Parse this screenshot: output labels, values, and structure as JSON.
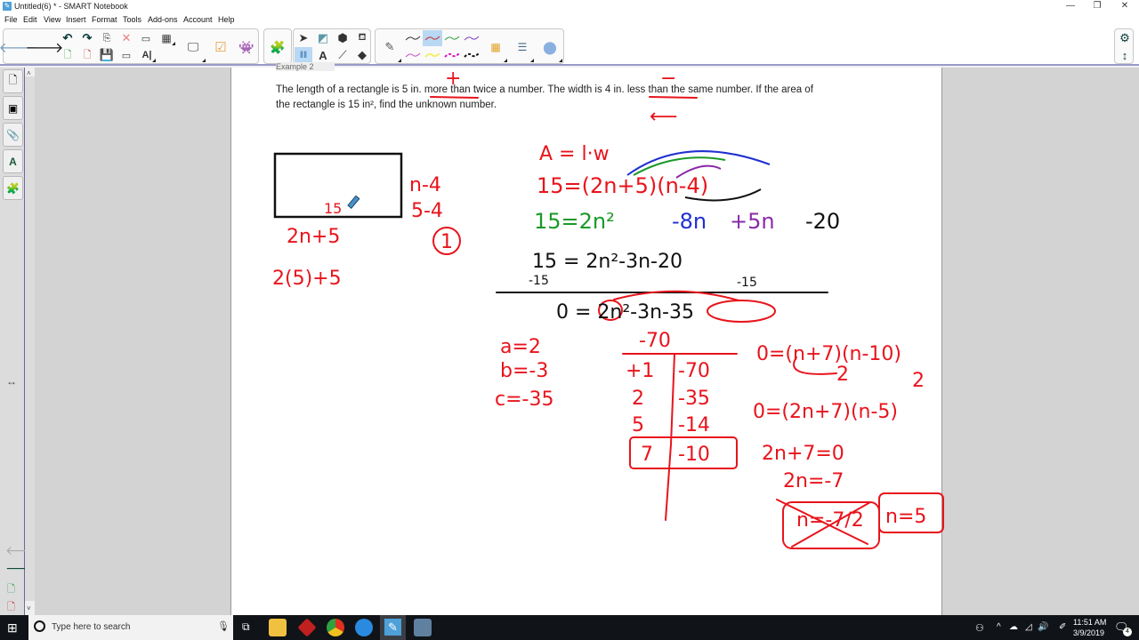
{
  "window": {
    "title": "Untitled(6) * - SMART Notebook",
    "minimize": "—",
    "restore": "❐",
    "close": "✕"
  },
  "menu": [
    "File",
    "Edit",
    "View",
    "Insert",
    "Format",
    "Tools",
    "Add-ons",
    "Account",
    "Help"
  ],
  "toolbar": {
    "back": "back-arrow",
    "forward": "forward-arrow",
    "undo": "↶",
    "redo": "↷",
    "selected_tool": "pen-color-blue"
  },
  "sidebar": {
    "tabs": [
      "page-sorter",
      "gallery",
      "attachments",
      "properties",
      "add-ons"
    ],
    "resize_handle": "↔"
  },
  "page": {
    "header_cut": "Example 2",
    "problem_line1_a": "The length of a rectangle is 5 in. ",
    "problem_line1_u1": "more than",
    "problem_line1_b": " twice a number.  The width is 4 in. ",
    "problem_line1_u2": "less than",
    "problem_line1_c": " the same number.  If the area of",
    "problem_line2": "the rectangle is 15 in², find the unknown number."
  },
  "handwriting": {
    "plus": "+",
    "minus": "−",
    "arrow_left": "⟵",
    "rect_label": "15",
    "length_expr": "2n+5",
    "length_sub": "2(5)+5",
    "width_expr": "n-4",
    "width_sub": "5-4",
    "width_result": "1",
    "area_formula": "A = l·w",
    "eq1": "15=(2n+5)(n-4)",
    "eq2_a": "15=2n²",
    "eq2_b": "-8n",
    "eq2_c": "+5n",
    "eq2_d": "-20",
    "eq3": "15 = 2n²-3n-20",
    "eq3_sub_left": "-15",
    "eq3_sub_right": "-15",
    "eq4": "0 = 2n²-3n-35",
    "coef_a": "a=2",
    "coef_b": "b=-3",
    "coef_c": "c=-35",
    "ac_product": "-70",
    "factor_rows": [
      {
        "left": "+1",
        "right": "-70"
      },
      {
        "left": "2",
        "right": "-35"
      },
      {
        "left": "5",
        "right": "-14"
      },
      {
        "left": "7",
        "right": "-10"
      }
    ],
    "f1": "0=(n+7)(n-10)",
    "f1_div_a": "2",
    "f1_div_b": "2",
    "f2": "0=(2n+7)(n-5)",
    "s1": "2n+7=0",
    "s2": "2n=-7",
    "s3": "n=-7/2",
    "s4": "n=5"
  },
  "taskbar": {
    "search_placeholder": "Type here to search",
    "time": "11:51 AM",
    "date": "3/9/2019",
    "notifications": "4"
  },
  "colors": {
    "ink_red": "#e8141c",
    "ink_green": "#1a9a28",
    "ink_blue": "#2030d0",
    "ink_purple": "#8a2aa8",
    "ink_black": "#111111"
  }
}
